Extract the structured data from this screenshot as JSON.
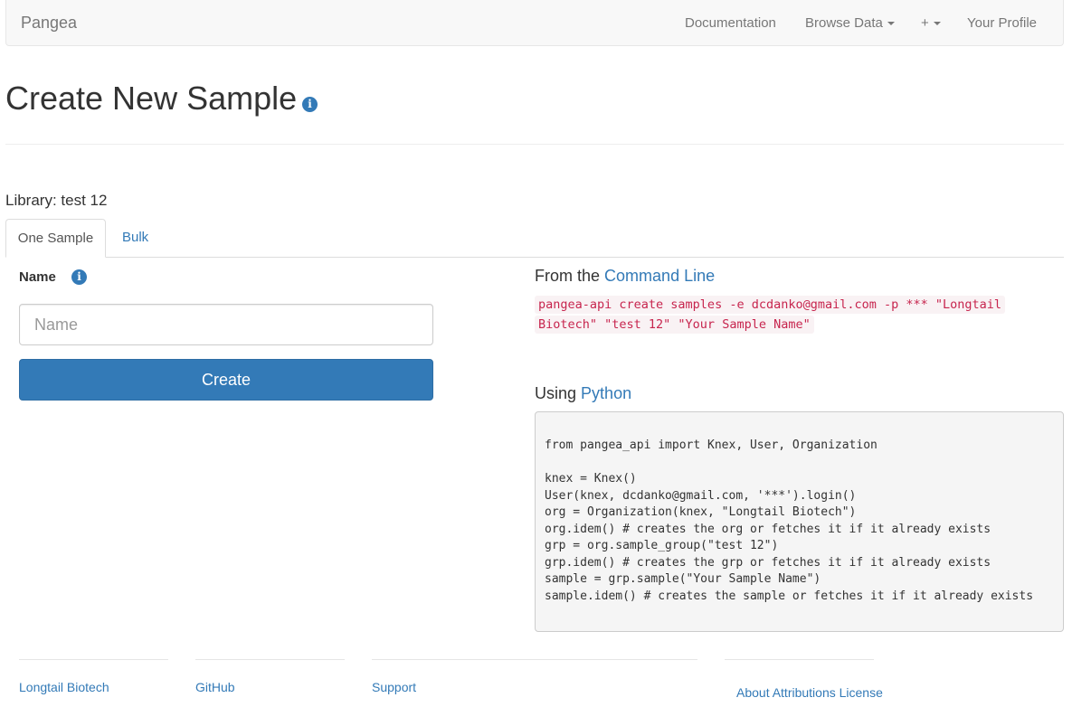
{
  "navbar": {
    "brand": "Pangea",
    "items": [
      {
        "label": "Documentation"
      },
      {
        "label": "Browse Data"
      },
      {
        "label": "+"
      },
      {
        "label": "Your Profile"
      }
    ]
  },
  "page": {
    "title": "Create New Sample",
    "library_label": "Library: test 12"
  },
  "tabs": [
    {
      "label": "One Sample",
      "active": true
    },
    {
      "label": "Bulk",
      "active": false
    }
  ],
  "form": {
    "name_label": "Name",
    "name_placeholder": "Name",
    "name_value": "",
    "create_button": "Create"
  },
  "cli": {
    "heading_prefix": "From the",
    "heading_link": "Command Line",
    "command": "pangea-api create samples -e dcdanko@gmail.com -p *** \"Longtail Biotech\" \"test 12\" \"Your Sample Name\""
  },
  "python": {
    "heading_prefix": "Using",
    "heading_link": "Python",
    "code": "from pangea_api import Knex, User, Organization\n\nknex = Knex()\nUser(knex, dcdanko@gmail.com, '***').login()\norg = Organization(knex, \"Longtail Biotech\")\norg.idem() # creates the org or fetches it if it already exists\ngrp = org.sample_group(\"test 12\")\ngrp.idem() # creates the grp or fetches it if it already exists\nsample = grp.sample(\"Your Sample Name\")\nsample.idem() # creates the sample or fetches it if it already exists"
  },
  "footer": {
    "links": [
      "Longtail Biotech",
      "GitHub",
      "Support",
      "About Attributions License"
    ]
  },
  "icons": {
    "title_info": "info-circle-icon",
    "name_info": "info-circle-icon"
  },
  "colors": {
    "primary": "#337ab7",
    "code_text": "#c7254e",
    "code_bg": "#f9f2f4",
    "navbar_bg": "#f8f8f8"
  }
}
